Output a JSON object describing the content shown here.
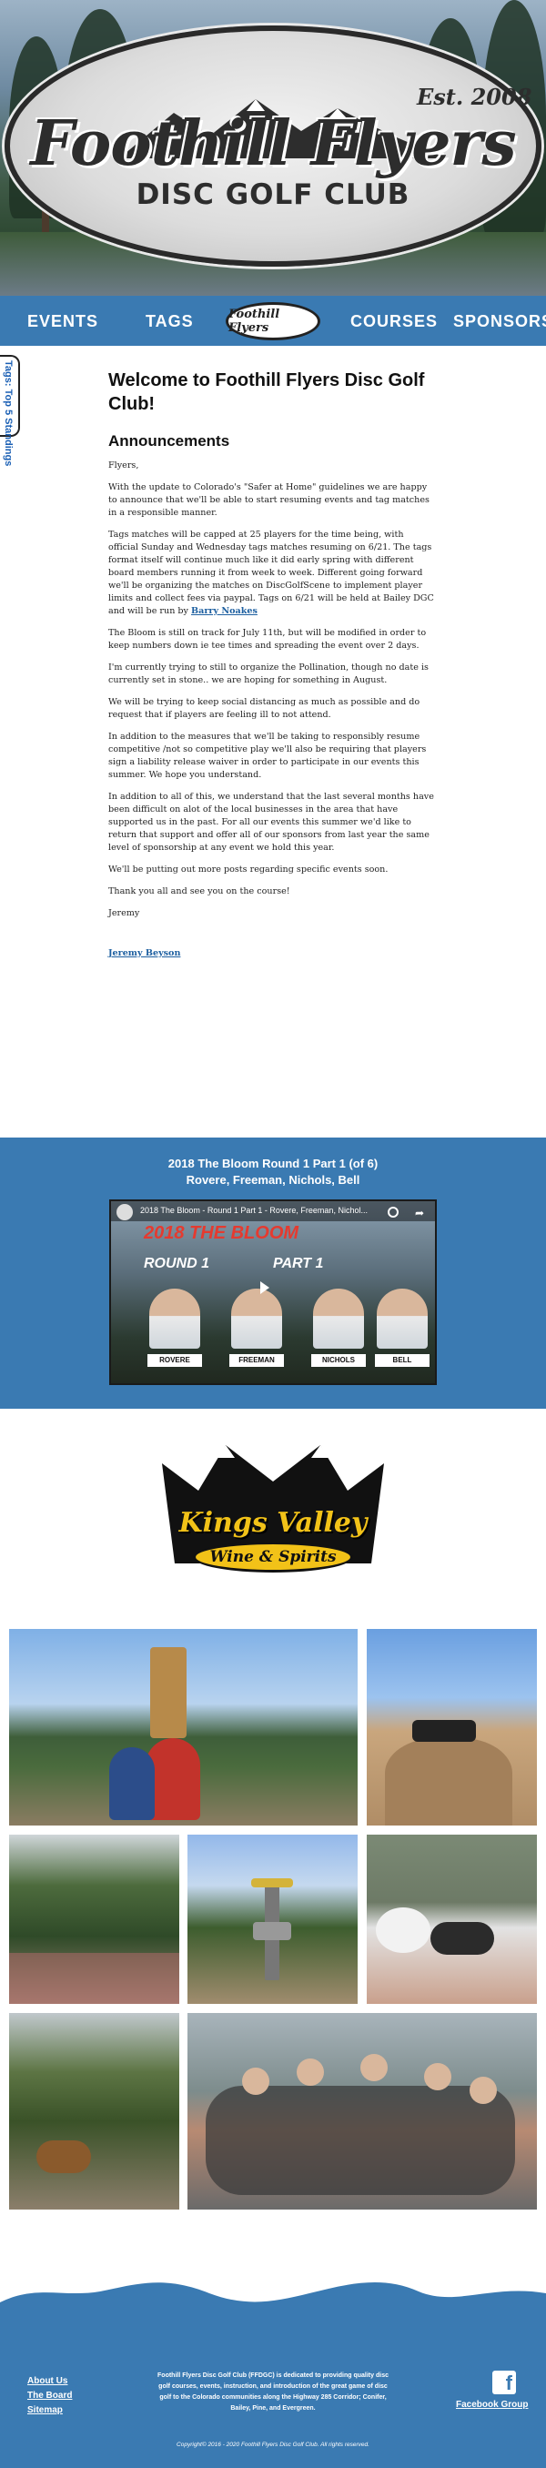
{
  "hero": {
    "title": "Foothill Flyers",
    "established": "Est. 2008",
    "subtitle": "DISC GOLF CLUB"
  },
  "nav": {
    "events": "EVENTS",
    "tags": "TAGS",
    "courses": "COURSES",
    "sponsors": "SPONSORS",
    "badge_text": "Foothill Flyers"
  },
  "side_tab": {
    "label": "Tags: Top 5 Standings"
  },
  "article": {
    "heading": "Welcome to Foothill Flyers Disc Golf Club!",
    "subheading": "Announcements",
    "greeting": "Flyers,",
    "p1": "With the update to Colorado's \"Safer at Home\" guidelines we are happy to announce that we'll be able to start resuming events and tag matches in a responsible manner.",
    "p2": "Tags matches will be capped at 25 players for the time being, with official Sunday and Wednesday tags matches resuming on 6/21. The tags format itself will continue much like it did early spring with different board members running it from week to week. Different going forward we'll be organizing the matches on DiscGolfScene to implement player limits and collect fees via paypal. Tags on 6/21 will be held at Bailey DGC and will be run by ",
    "p2_link": "Barry Noakes",
    "p3": "The Bloom is still on track for July 11th, but will be modified in order to keep numbers down ie tee times and spreading the event over 2 days.",
    "p4": "I'm currently trying to still to organize the Pollination, though no date is currently set in stone.. we are hoping for something in August.",
    "p5": "We will be trying to keep social distancing as much as possible and do request that if players are feeling ill to not attend.",
    "p6": "In addition to the measures that we'll be taking to responsibly resume competitive /not so competitive play we'll also be requiring that players sign a liability release waiver in order to participate in our events this summer. We hope you understand.",
    "p7": "In addition to all of this, we understand that the last several months have been difficult on alot of the local businesses in the area that have supported us in the past. For all our events this summer we'd like to return that support and offer all of our sponsors from last year the same level of sponsorship at any event we hold this year.",
    "p8": "We'll be putting out more posts regarding specific events soon.",
    "p9": "Thank you all and see you on the course!",
    "closing": "Jeremy",
    "author_link": "Jeremy Beyson"
  },
  "video": {
    "title_line1": "2018 The Bloom Round 1 Part 1 (of 6)",
    "title_line2": "Rovere, Freeman, Nichols, Bell",
    "yt_title": "2018 The Bloom - Round 1 Part 1 - Rovere, Freeman, Nichol...",
    "overlay_title": "2018 THE BLOOM",
    "round": "ROUND 1",
    "part": "PART 1",
    "players": [
      "ROVERE",
      "FREEMAN",
      "NICHOLS",
      "BELL"
    ]
  },
  "sponsor": {
    "name": "Kings Valley",
    "tagline": "Wine & Spirits"
  },
  "footer": {
    "link_about": "About Us",
    "link_board": "The Board",
    "link_sitemap": "Sitemap",
    "about_text": "Foothill Flyers Disc Golf Club (FFDGC) is dedicated to providing quality disc golf courses, events, instruction, and introduction of the great game of disc golf to the Colorado communities along the Highway 285 Corridor; Conifer, Bailey, Pine, and Evergreen.",
    "copyright": "Copyright© 2016 - 2020 Foothill Flyers Disc Golf Club. All rights reserved.",
    "facebook_label": "Facebook Group",
    "facebook_icon": "f"
  },
  "colors": {
    "brand_blue": "#3a7ab2",
    "link_blue": "#1d5fa0",
    "sponsor_gold": "#f2c218"
  }
}
